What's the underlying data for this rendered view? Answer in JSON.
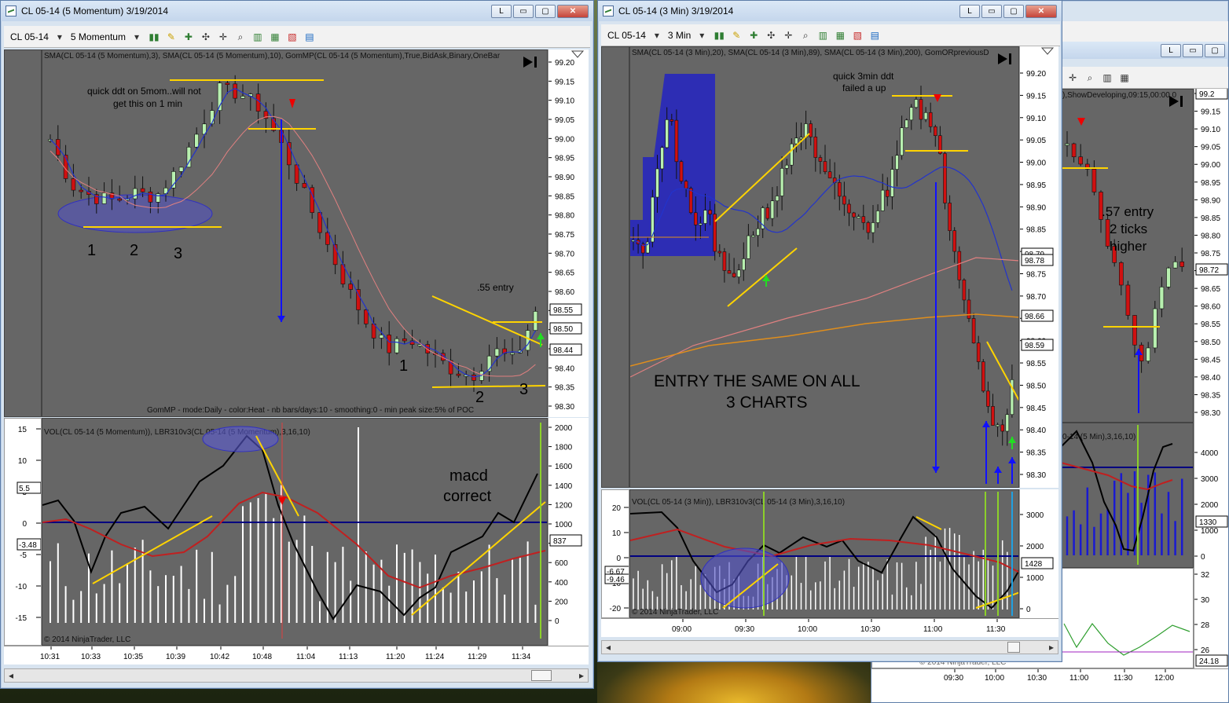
{
  "win1": {
    "title": "CL 05-14 (5 Momentum)  3/19/2014",
    "instrument": "CL 05-14",
    "interval": "5 Momentum",
    "price_indicators": "SMA(CL 05-14 (5 Momentum),3), SMA(CL 05-14 (5 Momentum),10), GomMP(CL 05-14 (5 Momentum),True,BidAsk,Binary,OneBar",
    "gom_footer": "GomMP - mode:Daily - color:Heat - nb bars/days:10 - smoothing:0 - min peak size:5% of POC",
    "vol_indicators": "VOL(CL 05-14 (5 Momentum)), LBR310v3(CL 05-14 (5 Momentum),3,16,10)",
    "copyright": "© 2014 NinjaTrader, LLC",
    "price_ticks": [
      "99.20",
      "99.15",
      "99.10",
      "99.05",
      "99.00",
      "98.95",
      "98.90",
      "98.85",
      "98.80",
      "98.75",
      "98.70",
      "98.65",
      "98.60",
      "98.55",
      "98.50",
      "98.45",
      "98.40",
      "98.35",
      "98.30"
    ],
    "price_tags": [
      "98.55",
      "98.50",
      "98.44"
    ],
    "vol_ticks": [
      "2000",
      "1800",
      "1600",
      "1400",
      "1200",
      "1000",
      "800",
      "600",
      "400",
      "200",
      "0"
    ],
    "osc_ticks": [
      "15",
      "10",
      "5",
      "0",
      "-5",
      "-10",
      "-15"
    ],
    "osc_tags": [
      "5.5",
      "-3.48"
    ],
    "vol_tag": "837",
    "time_ticks": [
      "10:31",
      "10:33",
      "10:35",
      "10:39",
      "10:42",
      "10:48",
      "11:04",
      "11:13",
      "11:20",
      "11:24",
      "11:29",
      "11:34"
    ],
    "annotations": {
      "ddt_note_1": "quick ddt on 5mom..will not",
      "ddt_note_2": "get this on 1 min",
      "n1": "1",
      "n2": "2",
      "n3": "3",
      "entry": ".55 entry",
      "b1": "1",
      "b2": "2",
      "b3": "3",
      "macd_1": "macd",
      "macd_2": "correct"
    }
  },
  "win2": {
    "title": "CL 05-14 (3 Min)  3/19/2014",
    "instrument": "CL 05-14",
    "interval": "3 Min",
    "price_indicators": "SMA(CL 05-14 (3 Min),20), SMA(CL 05-14 (3 Min),89), SMA(CL 05-14 (3 Min),200), GomORpreviousD",
    "vol_indicators": "VOL(CL 05-14 (3 Min)), LBR310v3(CL 05-14 (3 Min),3,16,10)",
    "copyright": "© 2014 NinjaTrader, LLC",
    "price_ticks": [
      "99.20",
      "99.15",
      "99.10",
      "99.05",
      "99.00",
      "98.95",
      "98.90",
      "98.85",
      "98.80",
      "98.75",
      "98.70",
      "98.65",
      "98.60",
      "98.55",
      "98.50",
      "98.45",
      "98.40",
      "98.35",
      "98.30"
    ],
    "price_tags": [
      "98.79",
      "98.78",
      "98.66",
      "98.59"
    ],
    "vol_ticks": [
      "3000",
      "2000",
      "1000",
      "0"
    ],
    "osc_ticks": [
      "20",
      "10",
      "0",
      "-10",
      "-20"
    ],
    "osc_tags": [
      "-6.67",
      "-9.46"
    ],
    "vol_tag": "1428",
    "time_ticks": [
      "09:00",
      "09:30",
      "10:00",
      "10:30",
      "11:00",
      "11:30"
    ],
    "annotations": {
      "ddt_1": "quick 3min ddt",
      "ddt_2": "failed a up",
      "entry_1": "ENTRY THE SAME ON ALL",
      "entry_2": "3 CHARTS"
    }
  },
  "win3": {
    "indicator_fragment": "),ShowDeveloping,09:15,00:00,0",
    "osc_fragment": "0-14 (5 Min),3,16,10)",
    "copyright_fragment": "© 2014 NinjaTrader, LLC",
    "price_ticks": [
      "99.20",
      "99.15",
      "99.10",
      "99.05",
      "99.00",
      "98.95",
      "98.90",
      "98.85",
      "98.80",
      "98.75",
      "98.70",
      "98.65",
      "98.60",
      "98.55",
      "98.50",
      "98.45",
      "98.40",
      "98.35",
      "98.30"
    ],
    "price_tags": [
      "99.2",
      "98.72"
    ],
    "vol_ticks": [
      "4000",
      "3000",
      "2000",
      "1000",
      "0"
    ],
    "vol_tag": "1330",
    "lower_ticks": [
      "32",
      "30",
      "28",
      "26"
    ],
    "lower_tag": "24.18",
    "time_ticks": [
      "09:30",
      "10:00",
      "10:30",
      "11:00",
      "11:30",
      "12:00"
    ],
    "annotations": {
      "entry_1": ".57 entry",
      "entry_2": "2 ticks",
      "entry_3": "higher"
    }
  },
  "window_controls": {
    "restore": "L",
    "minimize": "▭",
    "maximize": "▢",
    "close": "✕"
  },
  "chart_data": [
    {
      "type": "candlestick",
      "title": "CL 05-14 (5 Momentum)  3/19/2014",
      "x_categories": [
        "10:31",
        "10:33",
        "10:35",
        "10:39",
        "10:42",
        "10:48",
        "11:04",
        "11:13",
        "11:20",
        "11:24",
        "11:29",
        "11:34"
      ],
      "ylim": [
        98.3,
        99.2
      ],
      "close_estimates": [
        99.0,
        98.85,
        98.85,
        98.86,
        99.1,
        99.12,
        98.95,
        98.65,
        98.45,
        98.42,
        98.4,
        98.55
      ],
      "last_price": 98.55
    },
    {
      "type": "candlestick",
      "title": "CL 05-14 (3 Min)  3/19/2014",
      "x_categories": [
        "09:00",
        "09:30",
        "10:00",
        "10:30",
        "11:00",
        "11:30"
      ],
      "ylim": [
        98.3,
        99.2
      ],
      "close_estimates": [
        98.85,
        98.8,
        99.05,
        98.95,
        99.1,
        98.4
      ],
      "last_price": 98.59
    },
    {
      "type": "candlestick",
      "x_categories": [
        "09:30",
        "10:00",
        "10:30",
        "11:00",
        "11:30",
        "12:00"
      ],
      "ylim": [
        98.3,
        99.2
      ],
      "last_price": 98.72
    }
  ]
}
